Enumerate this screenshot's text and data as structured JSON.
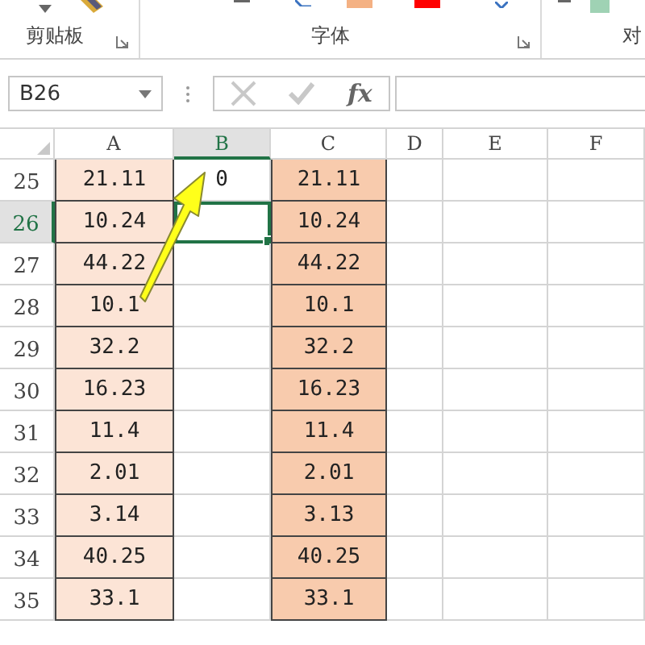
{
  "ribbon": {
    "groups": [
      {
        "label": "剪贴板"
      },
      {
        "label": "字体"
      },
      {
        "label": "对"
      }
    ]
  },
  "formula_bar": {
    "name_box": "B26",
    "function_label": "fx"
  },
  "columns": [
    {
      "label": "A",
      "selected": false,
      "color": "#fce4d6"
    },
    {
      "label": "B",
      "selected": true
    },
    {
      "label": "C",
      "selected": false,
      "color": "#f8cbad"
    },
    {
      "label": "D",
      "selected": false
    },
    {
      "label": "E",
      "selected": false
    },
    {
      "label": "F",
      "selected": false
    }
  ],
  "rows": [
    {
      "number": "25",
      "selected": false,
      "cells": [
        {
          "text": "21.11",
          "selected": false
        },
        {
          "text": "0",
          "selected": false
        },
        {
          "text": "21.11",
          "selected": false
        }
      ]
    },
    {
      "number": "26",
      "selected": true,
      "cells": [
        {
          "text": "10.24",
          "selected": false
        },
        {
          "text": "",
          "selected": true
        },
        {
          "text": "10.24",
          "selected": false
        }
      ]
    },
    {
      "number": "27",
      "selected": false,
      "cells": [
        {
          "text": "44.22",
          "selected": false
        },
        {
          "text": "",
          "selected": false
        },
        {
          "text": "44.22",
          "selected": false
        }
      ]
    },
    {
      "number": "28",
      "selected": false,
      "cells": [
        {
          "text": "10.1",
          "selected": false
        },
        {
          "text": "",
          "selected": false
        },
        {
          "text": "10.1",
          "selected": false
        }
      ]
    },
    {
      "number": "29",
      "selected": false,
      "cells": [
        {
          "text": "32.2",
          "selected": false
        },
        {
          "text": "",
          "selected": false
        },
        {
          "text": "32.2",
          "selected": false
        }
      ]
    },
    {
      "number": "30",
      "selected": false,
      "cells": [
        {
          "text": "16.23",
          "selected": false
        },
        {
          "text": "",
          "selected": false
        },
        {
          "text": "16.23",
          "selected": false
        }
      ]
    },
    {
      "number": "31",
      "selected": false,
      "cells": [
        {
          "text": "11.4",
          "selected": false
        },
        {
          "text": "",
          "selected": false
        },
        {
          "text": "11.4",
          "selected": false
        }
      ]
    },
    {
      "number": "32",
      "selected": false,
      "cells": [
        {
          "text": "2.01",
          "selected": false
        },
        {
          "text": "",
          "selected": false
        },
        {
          "text": "2.01",
          "selected": false
        }
      ]
    },
    {
      "number": "33",
      "selected": false,
      "cells": [
        {
          "text": "3.14",
          "selected": false
        },
        {
          "text": "",
          "selected": false
        },
        {
          "text": "3.13",
          "selected": false
        }
      ]
    },
    {
      "number": "34",
      "selected": false,
      "cells": [
        {
          "text": "40.25",
          "selected": false
        },
        {
          "text": "",
          "selected": false
        },
        {
          "text": "40.25",
          "selected": false
        }
      ]
    },
    {
      "number": "35",
      "selected": false,
      "cells": [
        {
          "text": "33.1",
          "selected": false
        },
        {
          "text": "",
          "selected": false
        },
        {
          "text": "33.1",
          "selected": false
        }
      ]
    }
  ]
}
